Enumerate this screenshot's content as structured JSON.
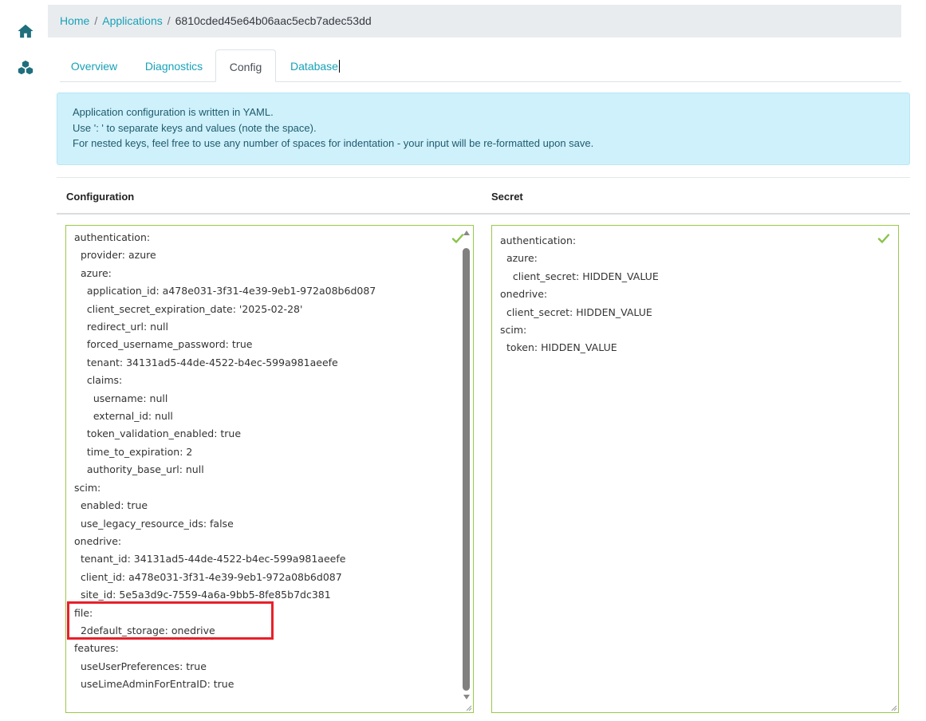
{
  "sidebar": {
    "home_icon": "home-icon",
    "apps_icon": "cubes-icon"
  },
  "breadcrumb": {
    "home": "Home",
    "applications": "Applications",
    "current": "6810cded45e64b06aac5ecb7adec53dd"
  },
  "tabs": [
    {
      "label": "Overview",
      "active": false
    },
    {
      "label": "Diagnostics",
      "active": false
    },
    {
      "label": "Config",
      "active": true
    },
    {
      "label": "Database",
      "active": false
    }
  ],
  "info": {
    "line1": "Application configuration is written in YAML.",
    "line2": "Use ': ' to separate keys and values (note the space).",
    "line3": "For nested keys, feel free to use any number of spaces for indentation - your input will be re-formatted upon save."
  },
  "sections": {
    "configuration": "Configuration",
    "secret": "Secret"
  },
  "config_editor": {
    "lines_before": "authentication:\n  provider: azure\n  azure:\n    application_id: a478e031-3f31-4e39-9eb1-972a08b6d087\n    client_secret_expiration_date: '2025-02-28'\n    redirect_url: null\n    forced_username_password: true\n    tenant: 34131ad5-44de-4522-b4ec-599a981aeefe\n    claims:\n      username: null\n      external_id: null\n    token_validation_enabled: true\n    time_to_expiration: 2\n    authority_base_url: null\nscim:\n  enabled: true\n  use_legacy_resource_ids: false\nonedrive:\n  tenant_id: 34131ad5-44de-4522-b4ec-599a981aeefe\n  client_id: a478e031-3f31-4e39-9eb1-972a08b6d087\n  site_id: 5e5a3d9c-7559-4a6a-9bb5-8fe85b7dc381\nfile:\n  2default_storage: ",
    "misspelled_word": "onedrive",
    "lines_after": "\nfeatures:\n  useUserPreferences: true\n  useLimeAdminForEntraID: true"
  },
  "secret_editor": {
    "text": "authentication:\n  azure:\n    client_secret: HIDDEN_VALUE\nonedrive:\n  client_secret: HIDDEN_VALUE\nscim:\n  token: HIDDEN_VALUE"
  },
  "colors": {
    "accent": "#17a2b8",
    "valid_border": "#9bc84a",
    "check": "#8bc34a",
    "highlight": "#e8202a"
  }
}
